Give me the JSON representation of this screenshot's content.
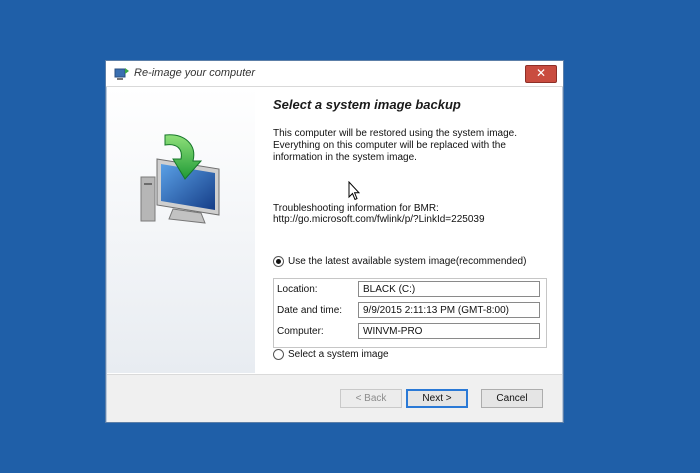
{
  "window": {
    "title": "Re-image your computer",
    "close_label": "✕"
  },
  "main": {
    "heading": "Select a system image backup",
    "description": "This computer will be restored using the system image. Everything on this computer will be replaced with the information in the system image.",
    "troubleshooting_line1": "Troubleshooting information for BMR:",
    "troubleshooting_line2": "http://go.microsoft.com/fwlink/p/?LinkId=225039",
    "option_latest": {
      "label": "Use the latest available system image(recommended)",
      "checked": true
    },
    "option_select": {
      "label": "Select a system image",
      "checked": false
    },
    "details": {
      "location_label": "Location:",
      "location_value": "BLACK (C:)",
      "datetime_label": "Date and time:",
      "datetime_value": "9/9/2015 2:11:13 PM (GMT-8:00)",
      "computer_label": "Computer:",
      "computer_value": "WINVM-PRO"
    }
  },
  "footer": {
    "back_label": "< Back",
    "next_label": "Next >",
    "cancel_label": "Cancel"
  },
  "colors": {
    "desktop": "#1f5fa8",
    "close_button": "#c94c3f",
    "default_button_border": "#2a79d6"
  },
  "icons": [
    "computer-restore-icon",
    "mouse-pointer-icon",
    "app-icon"
  ]
}
